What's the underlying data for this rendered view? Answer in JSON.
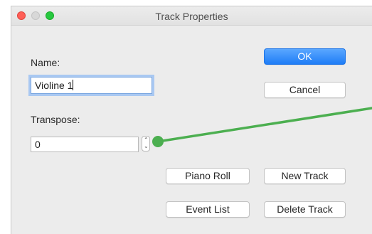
{
  "window": {
    "title": "Track Properties"
  },
  "form": {
    "name_label": "Name:",
    "name_value": "Violine 1",
    "transpose_label": "Transpose:",
    "transpose_value": "0"
  },
  "buttons": {
    "ok": "OK",
    "cancel": "Cancel",
    "piano_roll": "Piano Roll",
    "new_track": "New Track",
    "event_list": "Event List",
    "delete_track": "Delete Track"
  },
  "stepper": {
    "glyph": "⌃⌄"
  },
  "colors": {
    "annotation": "#4caf50",
    "default_button": "#1f7df6"
  }
}
